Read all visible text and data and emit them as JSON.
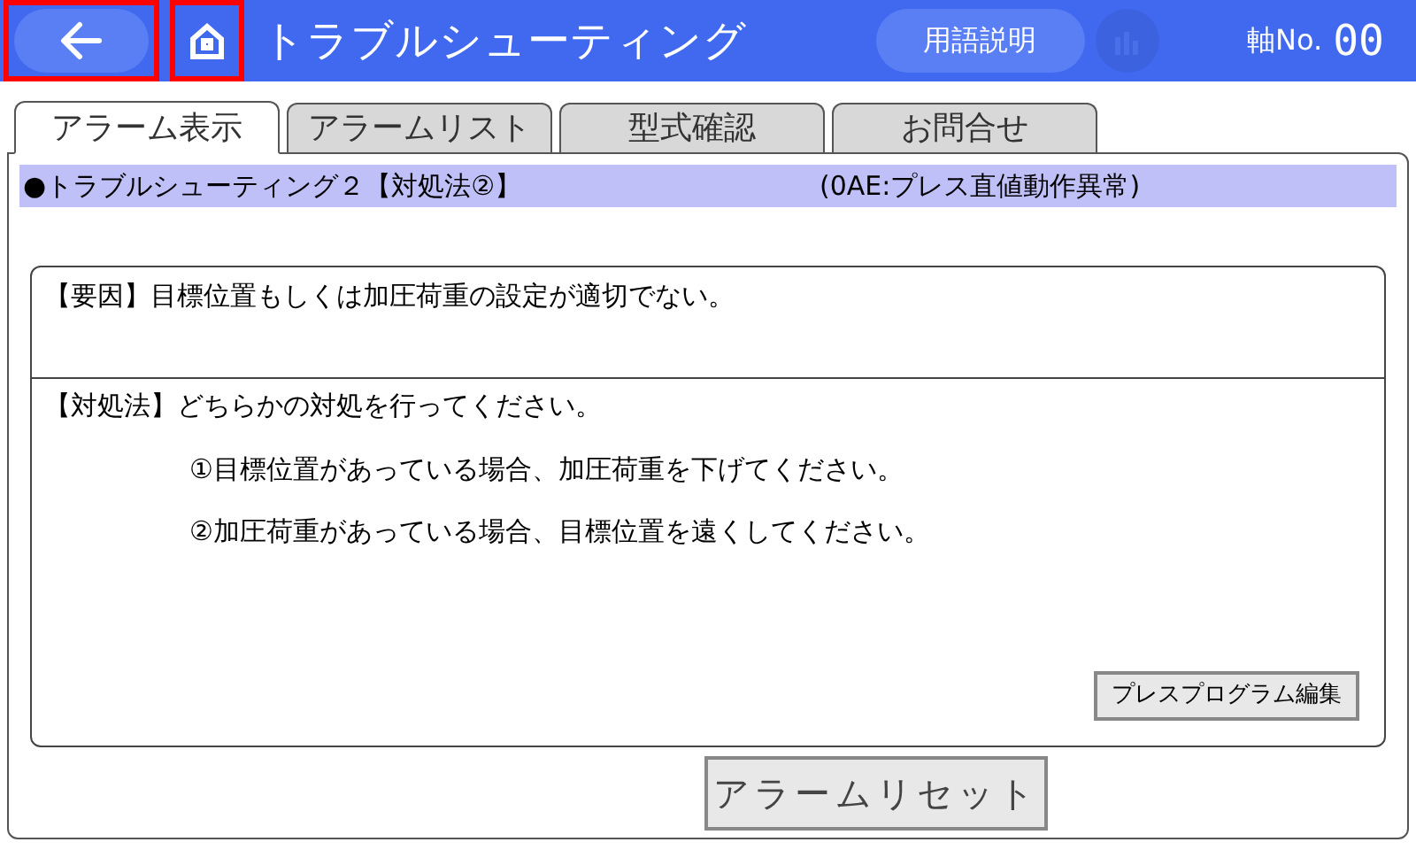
{
  "header": {
    "back_highlighted": true,
    "home_highlighted": true,
    "title": "トラブルシューティング",
    "glossary_button": "用語説明",
    "chart_button_disabled": true,
    "axis_label": "軸No.",
    "axis_value": "00"
  },
  "tabs": [
    {
      "label": "アラーム表示",
      "selected": true
    },
    {
      "label": "アラームリスト",
      "selected": false
    },
    {
      "label": "型式確認",
      "selected": false
    },
    {
      "label": "お問合せ",
      "selected": false
    }
  ],
  "alarm": {
    "title": "●トラブルシューティング２【対処法②】",
    "code": "(0AE:プレス直値動作異常)"
  },
  "cause": "【要因】目標位置もしくは加圧荷重の設定が適切でない。",
  "remedy": {
    "intro": "【対処法】どちらかの対処を行ってください。",
    "steps": [
      "①目標位置があっている場合、加圧荷重を下げてください。",
      "②加圧荷重があっている場合、目標位置を遠くしてください。"
    ]
  },
  "edit_button": "プレスプログラム編集",
  "reset_button": "アラームリセット"
}
